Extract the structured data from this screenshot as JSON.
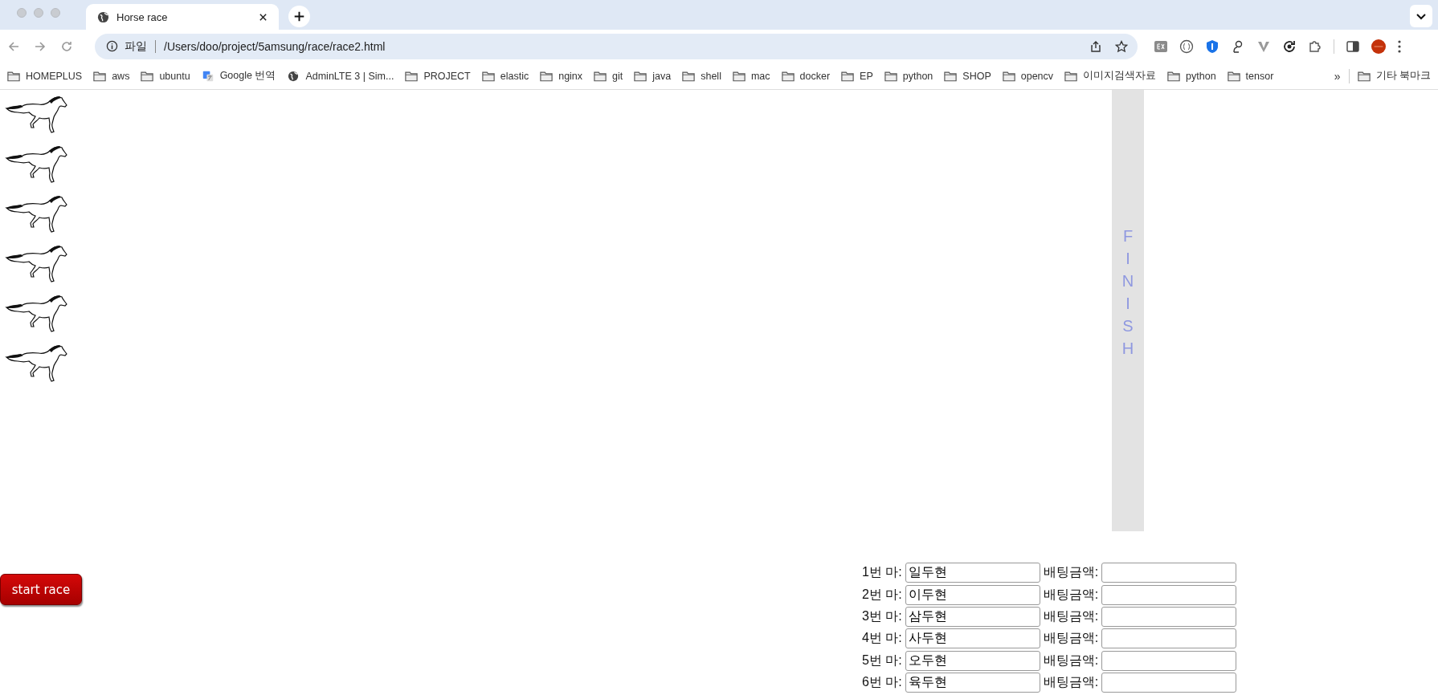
{
  "browser": {
    "tabs": [
      {
        "title": "Horse race",
        "selected": true
      }
    ],
    "address": {
      "scheme": "파일",
      "url": "/Users/doo/project/5amsung/race/race2.html"
    },
    "bookmarks": [
      {
        "label": "HOMEPLUS",
        "kind": "folder"
      },
      {
        "label": "aws",
        "kind": "folder"
      },
      {
        "label": "ubuntu",
        "kind": "folder"
      },
      {
        "label": "Google 번역",
        "kind": "translate"
      },
      {
        "label": "AdminLTE 3 | Sim...",
        "kind": "globe"
      },
      {
        "label": "PROJECT",
        "kind": "folder"
      },
      {
        "label": "elastic",
        "kind": "folder"
      },
      {
        "label": "nginx",
        "kind": "folder"
      },
      {
        "label": "git",
        "kind": "folder"
      },
      {
        "label": "java",
        "kind": "folder"
      },
      {
        "label": "shell",
        "kind": "folder"
      },
      {
        "label": "mac",
        "kind": "folder"
      },
      {
        "label": "docker",
        "kind": "folder"
      },
      {
        "label": "EP",
        "kind": "folder"
      },
      {
        "label": "python",
        "kind": "folder"
      },
      {
        "label": "SHOP",
        "kind": "folder"
      },
      {
        "label": "opencv",
        "kind": "folder"
      },
      {
        "label": "이미지검색자료",
        "kind": "folder"
      },
      {
        "label": "python",
        "kind": "folder"
      },
      {
        "label": "tensor",
        "kind": "folder"
      }
    ],
    "overflow": "»",
    "other_bookmarks": "기타 북마크"
  },
  "race": {
    "finish": "FINISH",
    "start_button": "start race",
    "entries": [
      {
        "label": "1번 마:",
        "name": "일두현",
        "bet_label": "배팅금액:"
      },
      {
        "label": "2번 마:",
        "name": "이두현",
        "bet_label": "배팅금액:"
      },
      {
        "label": "3번 마:",
        "name": "삼두현",
        "bet_label": "배팅금액:"
      },
      {
        "label": "4번 마:",
        "name": "사두현",
        "bet_label": "배팅금액:"
      },
      {
        "label": "5번 마:",
        "name": "오두현",
        "bet_label": "배팅금액:"
      },
      {
        "label": "6번 마:",
        "name": "육두현",
        "bet_label": "배팅금액:"
      }
    ]
  }
}
